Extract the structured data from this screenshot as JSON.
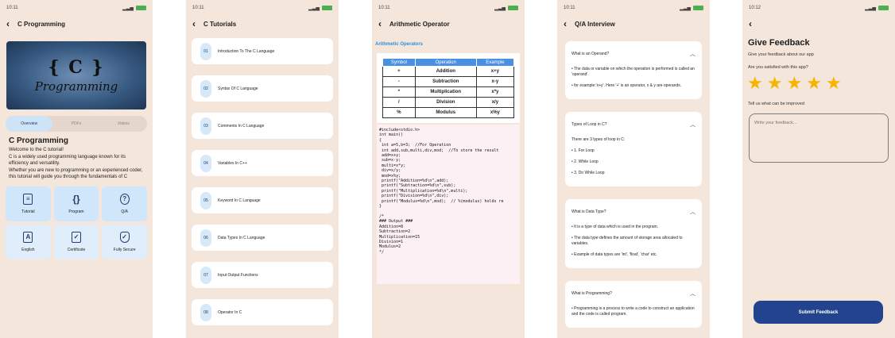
{
  "status": {
    "time1": "10:11",
    "time2": "10:11",
    "time3": "10:11",
    "time4": "10:11",
    "time5": "10:12"
  },
  "s1": {
    "title": "C Programming",
    "banner_c": "{ C }",
    "banner_prog": "Programming",
    "tabs": [
      "Overview",
      "PDFs",
      "Videos"
    ],
    "course_title": "C Programming",
    "desc": [
      "Welcome to the C tutorial!",
      "C is a widely used programming language known for its efficiency and versatility.",
      "Whether you are new to programming or an experienced coder, this tutorial will guide you through the fundamentals of C"
    ],
    "cards": [
      "Tutorial",
      "Program",
      "Q/A",
      "English",
      "Certificate",
      "Fully Secure"
    ]
  },
  "s2": {
    "title": "C Tutorials",
    "items": [
      {
        "num": "01",
        "label": "Introduction To The C Language"
      },
      {
        "num": "02",
        "label": "Syntax Of C Language"
      },
      {
        "num": "03",
        "label": "Comments In C Language"
      },
      {
        "num": "04",
        "label": "Variables In C++"
      },
      {
        "num": "05",
        "label": "Keyword In C Language"
      },
      {
        "num": "06",
        "label": "Data Types In C Language"
      },
      {
        "num": "07",
        "label": "Input Output Functions"
      },
      {
        "num": "08",
        "label": "Operator In C"
      }
    ]
  },
  "s3": {
    "title": "Arithmetic Operator",
    "section": "Arithmetic Operators",
    "headers": [
      "Symbol",
      "Operation",
      "Example"
    ],
    "rows": [
      [
        "+",
        "Addition",
        "x+y"
      ],
      [
        "-",
        "Subtraction",
        "x-y"
      ],
      [
        "*",
        "Multiplication",
        "x*y"
      ],
      [
        "/",
        "Division",
        "x/y"
      ],
      [
        "%",
        "Modulus",
        "x%y"
      ]
    ],
    "code": "#include<stdio.h>\nint main()\n{\n int a=5,b=3;  //For Operation\n int add,sub,multi,div,mod;  //To store the result\n add=x+y;\n sub=x-y;\n multi=x*y;\n div=x/y;\n mod=x%y;\n printf(\"Addition=%d\\n\",add);\n printf(\"Subtraction=%d\\n\",sub);\n printf(\"Multiplication=%d\\n\",multi);\n printf(\"Division=%d\\n\",div);\n printf(\"Modulus=%d\\n\",mod);  // %(modulus) holds re\n}\n\n/*\n### Output ###\nAddition=8\nSubtraction=2\nMultiplication=15\nDivision=1\nModulus=2\n*/"
  },
  "s4": {
    "title": "Q/A Interview",
    "qas": [
      {
        "q": "What is an Operand?",
        "a": [
          "• The data or variable on which the operation is performed is called an 'operand'.",
          "• for example:'x+y'. Here '+' is an operator, x & y are operands."
        ]
      },
      {
        "q": "Types of Loop in C?",
        "a": [
          "There are 3 types of loop in C:",
          "• 1. For Loop",
          "• 2. While Loop",
          "• 3. Do While Loop"
        ]
      },
      {
        "q": "What is Data Type?",
        "a": [
          "• It is a type of data which is used in the program.",
          "• The data type defines the amount of storage area allocated to variables.",
          "• Example of data types are 'int', 'float', 'char' etc."
        ]
      },
      {
        "q": "What is Programming?",
        "a": [
          "• Programming is a process to write a code to construct an application and the code is called program."
        ]
      }
    ]
  },
  "s5": {
    "title": "Give Feedback",
    "subtitle": "Give your feedback about our app",
    "question": "Are you satisfied with this app?",
    "rating": 5,
    "improve": "Tell us what can be improved",
    "placeholder": "Write your feedback...",
    "submit": "Submit Feedback"
  }
}
